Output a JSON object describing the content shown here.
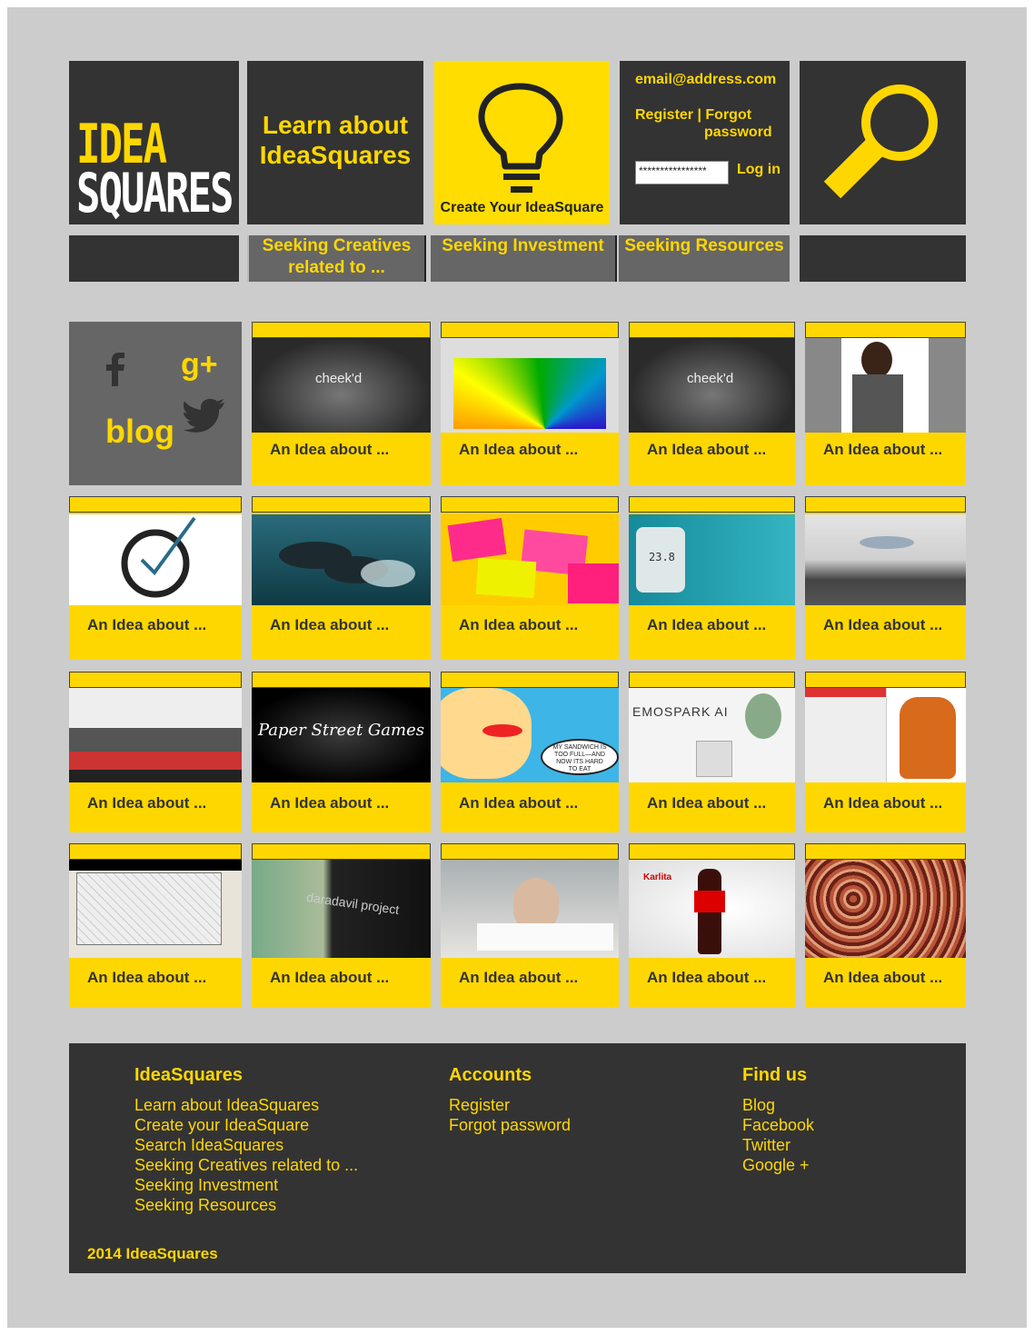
{
  "brand": {
    "word1": "IDEA",
    "word2": "SQUARES"
  },
  "header": {
    "learn": "Learn about IdeaSquares",
    "create": "Create Your IdeaSquare",
    "email": "email@address.com",
    "register": "Register | Forgot",
    "password_link": "password",
    "password_value": "****************",
    "login": "Log in"
  },
  "nav": {
    "creatives": "Seeking Creatives related to ...",
    "investment": "Seeking Investment",
    "resources": "Seeking Resources"
  },
  "social": {
    "gplus": "g+",
    "blog": "blog",
    "icons": [
      "facebook-icon",
      "google-plus-icon",
      "twitter-icon"
    ]
  },
  "tile_caption": "An Idea about ...",
  "tiles": [
    "An Idea about ...",
    "An Idea about ...",
    "An Idea about ...",
    "An Idea about ...",
    "An Idea about ...",
    "An Idea about ...",
    "An Idea about ...",
    "An Idea about ...",
    "An Idea about ...",
    "An Idea about ...",
    "An Idea about ...",
    "An Idea about ...",
    "An Idea about ...",
    "An Idea about ...",
    "An Idea about ...",
    "An Idea about ...",
    "An Idea about ...",
    "An Idea about ...",
    "An Idea about ..."
  ],
  "image_text": {
    "cheekd": "cheek'd",
    "timer": "23.8",
    "paper": "Paper Street Games",
    "comic": "MY SANDWICH IS TOO FULL—AND NOW ITS HARD TO EAT",
    "emospark": "EMOSPARK AI",
    "daredevil": "daradavil project",
    "karlita": "Karlita"
  },
  "footer": {
    "col1": {
      "title": "IdeaSquares",
      "links": [
        "Learn about IdeaSquares",
        "Create your IdeaSquare",
        "Search IdeaSquares",
        "Seeking Creatives related to ...",
        "Seeking Investment",
        "Seeking Resources"
      ]
    },
    "col2": {
      "title": "Accounts",
      "links": [
        "Register",
        "Forgot password"
      ]
    },
    "col3": {
      "title": "Find us",
      "links": [
        "Blog",
        "Facebook",
        "Twitter",
        "Google +"
      ]
    },
    "copyright": "2014 IdeaSquares"
  },
  "colors": {
    "accent": "#ffd700",
    "dark": "#333333",
    "background": "#cccccc",
    "nav": "#666666"
  }
}
